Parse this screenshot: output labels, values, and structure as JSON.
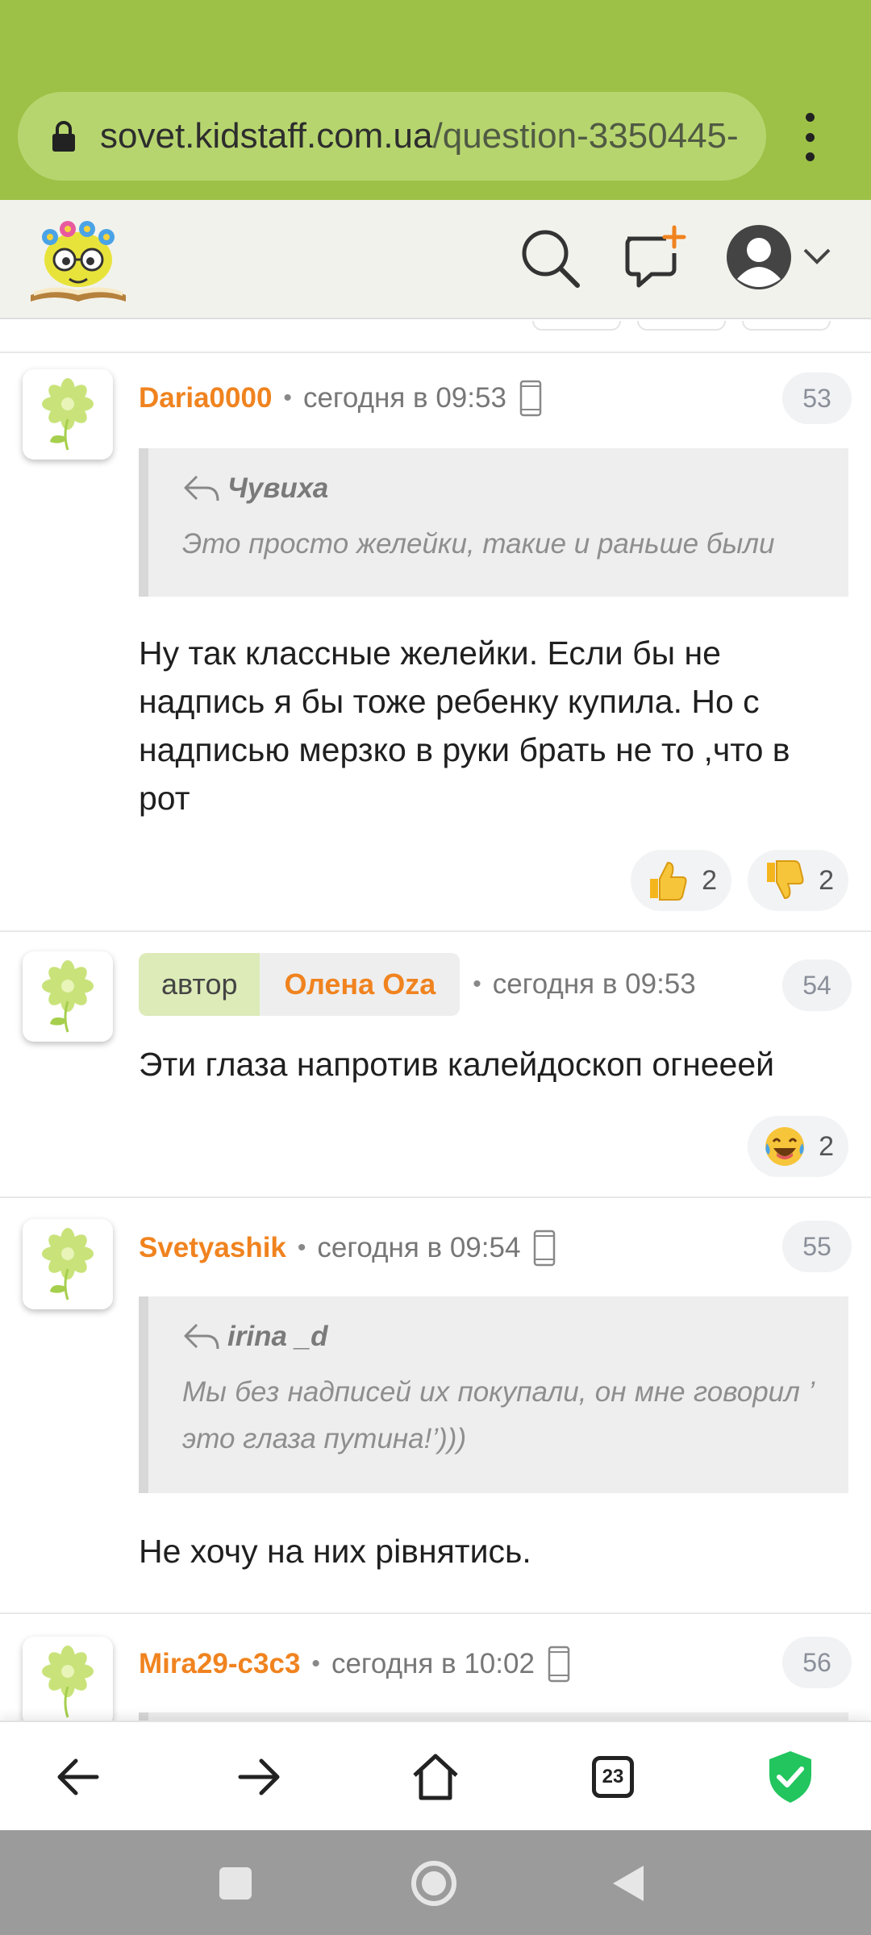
{
  "browser": {
    "url_host": "sovet.kidstaff.com.ua",
    "url_path": "/question-3350445-"
  },
  "comments": [
    {
      "username": "Daria0000",
      "time": "сегодня в 09:53",
      "number": "53",
      "quote_author": "Чувиха",
      "quote_text": "Это просто желейки, такие и раньше были",
      "body": "Ну так классные желейки. Если бы не надпись я бы тоже ребенку купила. Но с надписью мерзко в руки брать не то ,что в рот",
      "reactions": [
        {
          "icon": "thumbs-up-icon",
          "count": "2"
        },
        {
          "icon": "thumbs-down-icon",
          "count": "2"
        }
      ]
    },
    {
      "author_label": "автор",
      "username": "Олена Oza",
      "time": "сегодня в 09:53",
      "number": "54",
      "body": "Эти глаза напротив калейдоскоп огнееей",
      "reactions": [
        {
          "icon": "laughing-tears-icon",
          "count": "2"
        }
      ]
    },
    {
      "username": "Svetyashik",
      "time": "сегодня в 09:54",
      "number": "55",
      "quote_author": "irina _d",
      "quote_text": "Мы без надписей их покупали, он мне говорил ’ это глаза путина!’)))",
      "body": "Не хочу на них рівнятись."
    },
    {
      "username": "Mira29-c3c3",
      "time": "сегодня в 10:02",
      "number": "56"
    }
  ],
  "bottom_nav": {
    "tabs_count": "23"
  },
  "colors": {
    "browser_bar": "#9dc146",
    "username": "#f0831f",
    "author_badge": "#dcebb8",
    "shield": "#22c55e"
  }
}
